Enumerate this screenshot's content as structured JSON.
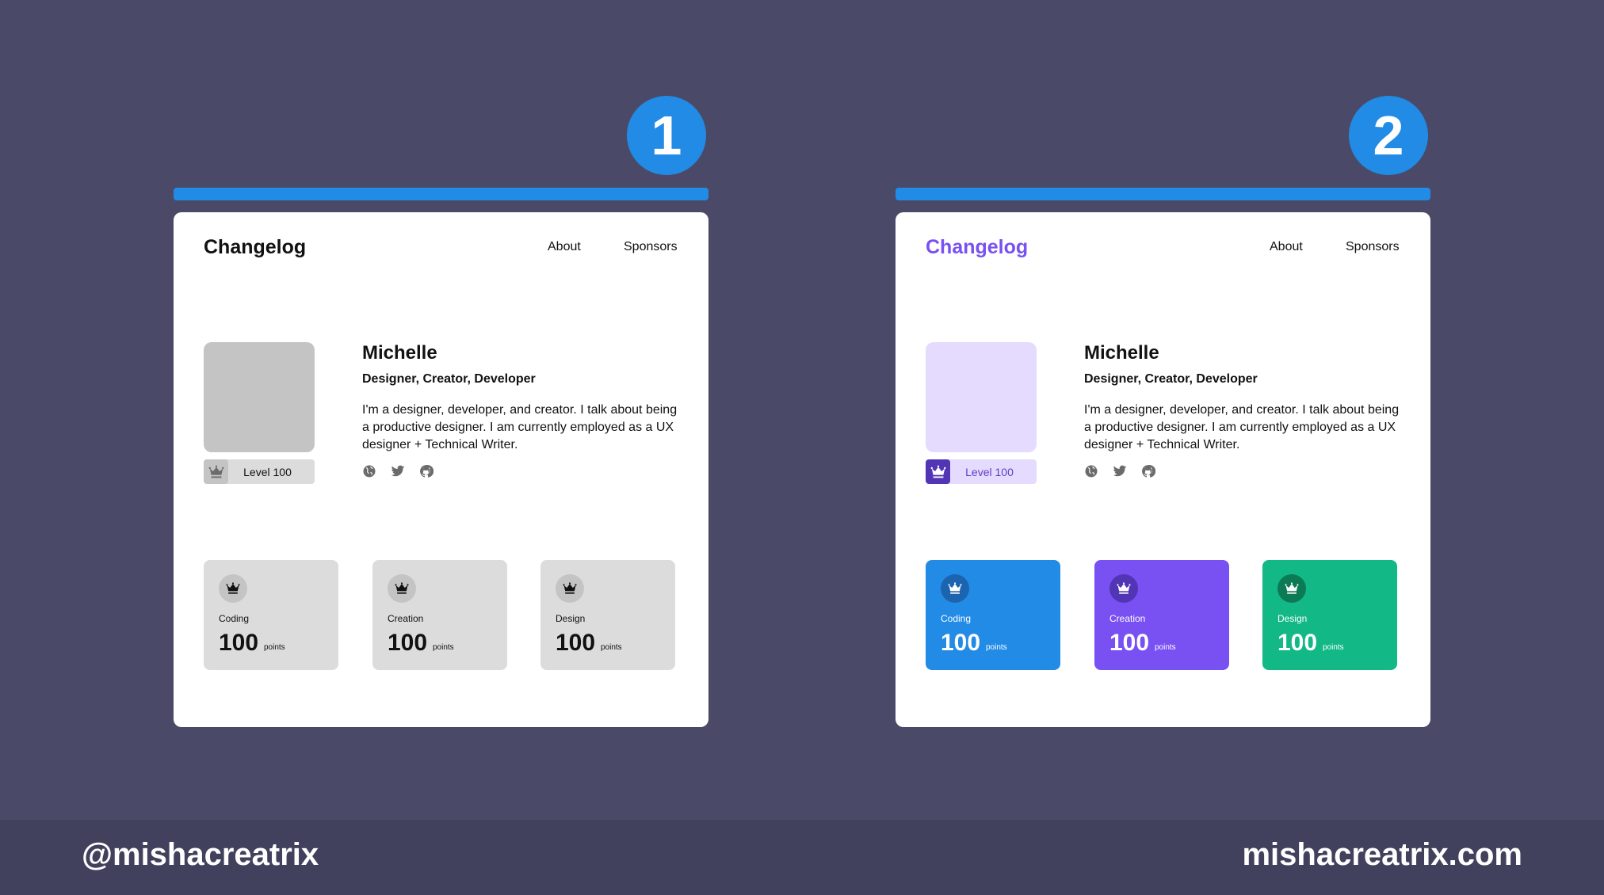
{
  "variants": [
    {
      "number": "1",
      "brand": "Changelog",
      "nav": [
        "About",
        "Sponsors"
      ],
      "profile": {
        "name": "Michelle",
        "role": "Designer, Creator, Developer",
        "bio": "I'm a designer, developer, and creator. I talk about being a productive designer. I am currently employed as a UX designer + Technical Writer.",
        "level": "Level 100",
        "socials": [
          "globe-icon",
          "twitter-icon",
          "github-icon"
        ]
      },
      "stats": [
        {
          "label": "Coding",
          "value": "100",
          "unit": "points"
        },
        {
          "label": "Creation",
          "value": "100",
          "unit": "points"
        },
        {
          "label": "Design",
          "value": "100",
          "unit": "points"
        }
      ],
      "colors": {
        "brand": "#111111",
        "avatar": "#c4c4c4",
        "level_bg": "#dcdcdc",
        "level_icon_bg": "#c4c4c4",
        "level_icon": "#6b6b6b",
        "level_text": "#111111",
        "stat_bg": [
          "#dcdcdc",
          "#dcdcdc",
          "#dcdcdc"
        ],
        "stat_icon_bg": [
          "#c4c4c4",
          "#c4c4c4",
          "#c4c4c4"
        ],
        "stat_icon": "#111111",
        "stat_text": "#111111"
      }
    },
    {
      "number": "2",
      "brand": "Changelog",
      "nav": [
        "About",
        "Sponsors"
      ],
      "profile": {
        "name": "Michelle",
        "role": "Designer, Creator, Developer",
        "bio": "I'm a designer, developer, and creator. I talk about being a productive designer. I am currently employed as a UX designer + Technical Writer.",
        "level": "Level 100",
        "socials": [
          "globe-icon",
          "twitter-icon",
          "github-icon"
        ]
      },
      "stats": [
        {
          "label": "Coding",
          "value": "100",
          "unit": "points"
        },
        {
          "label": "Creation",
          "value": "100",
          "unit": "points"
        },
        {
          "label": "Design",
          "value": "100",
          "unit": "points"
        }
      ],
      "colors": {
        "brand": "#7950f2",
        "avatar": "#e5dbff",
        "level_bg": "#e5dbff",
        "level_icon_bg": "#5235b5",
        "level_icon": "#ffffff",
        "level_text": "#5f3dc4",
        "stat_bg": [
          "#228be6",
          "#7950f2",
          "#12b886"
        ],
        "stat_icon_bg": [
          "#1c64b0",
          "#5235b5",
          "#0b7a55"
        ],
        "stat_icon": "#ffffff",
        "stat_text": "#ffffff"
      }
    }
  ],
  "footer": {
    "handle": "@mishacreatrix",
    "site": "mishacreatrix.com"
  }
}
